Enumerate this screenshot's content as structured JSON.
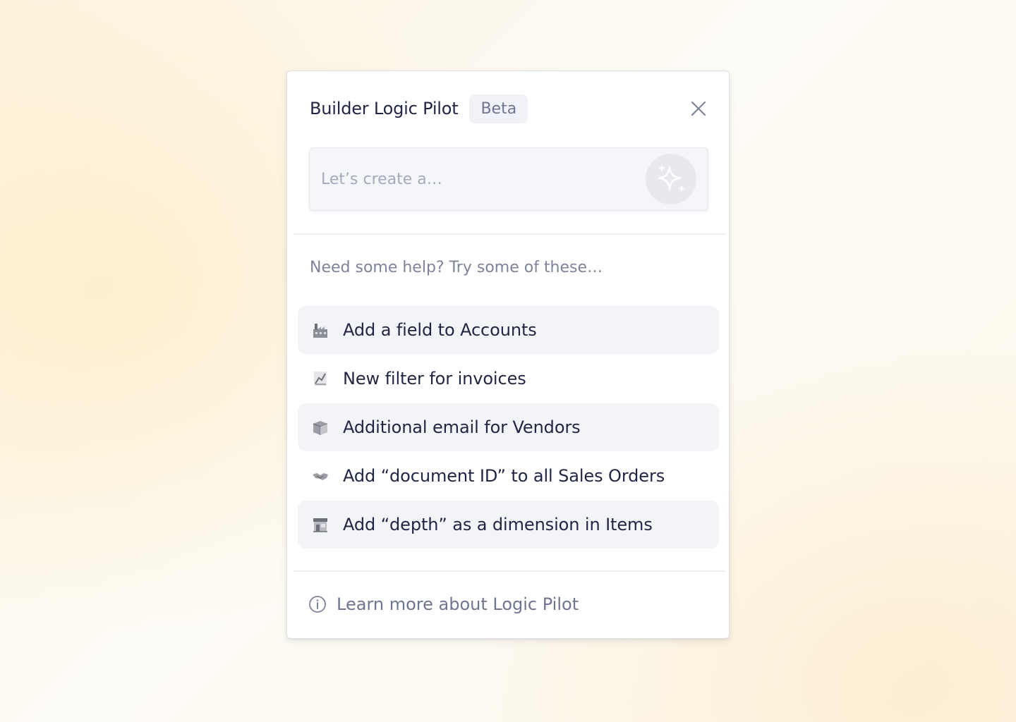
{
  "panel": {
    "title": "Builder Logic Pilot",
    "badge": "Beta",
    "close_icon": "close-icon"
  },
  "prompt": {
    "placeholder": "Let’s create a…",
    "value": "",
    "submit_icon": "sparkle-icon"
  },
  "help": {
    "text": "Need some help? Try some of these…"
  },
  "suggestions": {
    "items": [
      {
        "icon": "factory-icon",
        "label": "Add a field to Accounts",
        "shaded": true
      },
      {
        "icon": "chart-icon",
        "label": "New filter for invoices",
        "shaded": false
      },
      {
        "icon": "box-icon",
        "label": "Additional email for Vendors",
        "shaded": true
      },
      {
        "icon": "handshake-icon",
        "label": "Add “document ID” to all Sales Orders",
        "shaded": false
      },
      {
        "icon": "store-icon",
        "label": "Add “depth” as a dimension in Items",
        "shaded": true
      }
    ]
  },
  "footer": {
    "icon": "info-icon",
    "label": "Learn more about Logic Pilot"
  },
  "colors": {
    "text_primary": "#1f2542",
    "text_muted": "#7d8399",
    "row_shade": "#f3f4f8",
    "badge_bg": "#f0f2f7"
  }
}
